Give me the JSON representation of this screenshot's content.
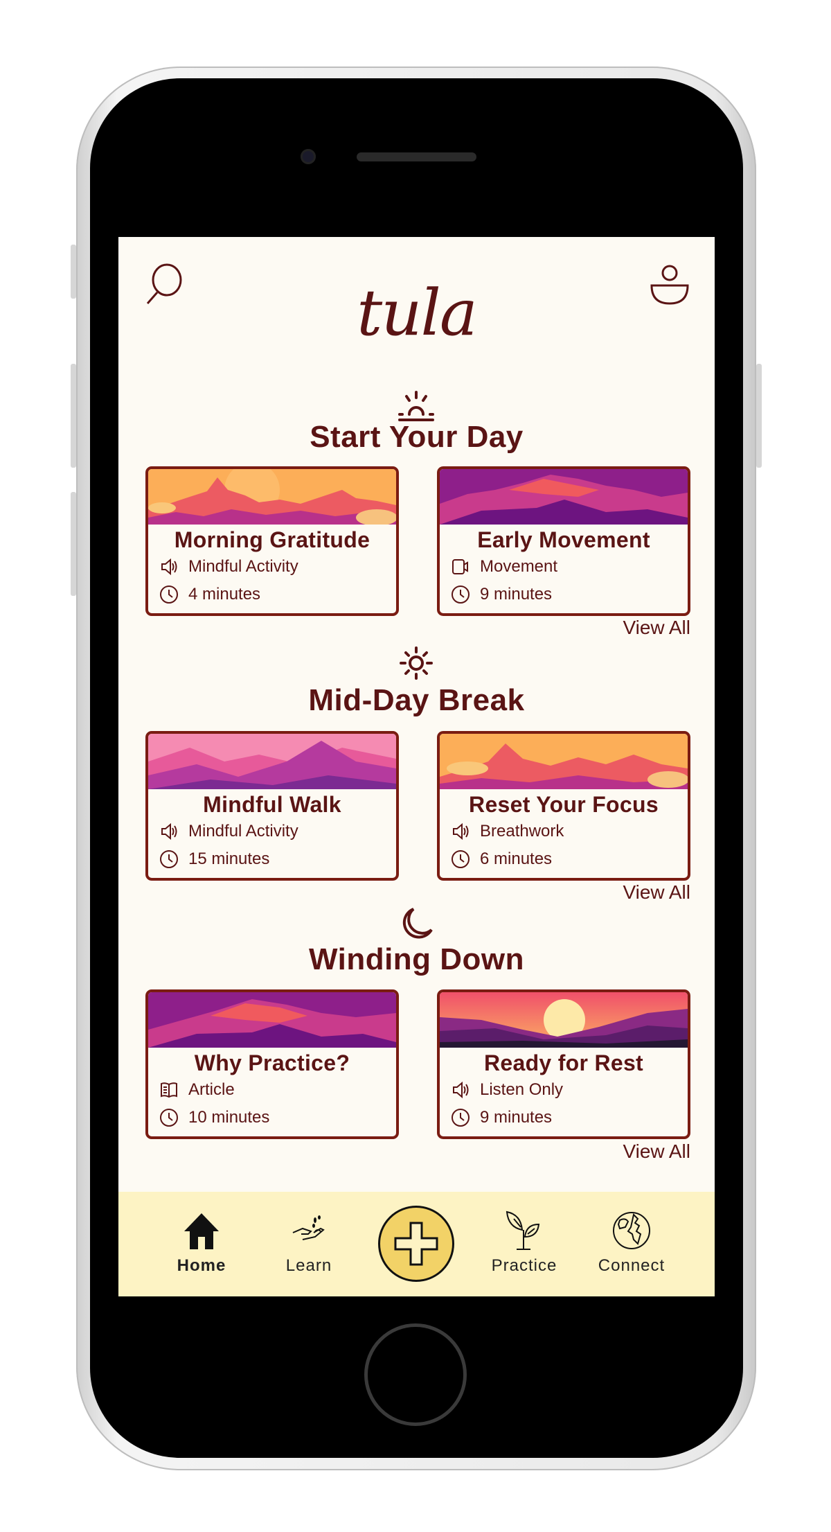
{
  "app": {
    "logo": "tula"
  },
  "header": {
    "search_icon": "search-icon",
    "profile_icon": "user-icon"
  },
  "colors": {
    "text": "#5a1414",
    "background": "#fdfaf3",
    "nav_background": "#fdf3c4",
    "add_button": "#f2d267",
    "card_border": "#7a1c12"
  },
  "sections": [
    {
      "icon": "sunrise-icon",
      "title": "Start Your Day",
      "view_all": "View All",
      "cards": [
        {
          "title": "Morning Gratitude",
          "type_icon": "speaker-icon",
          "type": "Mindful Activity",
          "duration": "4 minutes"
        },
        {
          "title": "Early Movement",
          "type_icon": "video-icon",
          "type": "Movement",
          "duration": "9 minutes"
        }
      ]
    },
    {
      "icon": "sun-icon",
      "title": "Mid-Day Break",
      "view_all": "View All",
      "cards": [
        {
          "title": "Mindful Walk",
          "type_icon": "speaker-icon",
          "type": "Mindful Activity",
          "duration": "15 minutes"
        },
        {
          "title": "Reset Your Focus",
          "type_icon": "speaker-icon",
          "type": "Breathwork",
          "duration": "6 minutes"
        }
      ]
    },
    {
      "icon": "moon-icon",
      "title": "Winding Down",
      "view_all": "View All",
      "cards": [
        {
          "title": "Why Practice?",
          "type_icon": "book-icon",
          "type": "Article",
          "duration": "10 minutes"
        },
        {
          "title": "Ready for Rest",
          "type_icon": "speaker-icon",
          "type": "Listen Only",
          "duration": "9 minutes"
        }
      ]
    }
  ],
  "nav": {
    "items": [
      {
        "label": "Home",
        "icon": "home-icon",
        "active": true
      },
      {
        "label": "Learn",
        "icon": "hand-seeds-icon"
      },
      {
        "label": "",
        "icon": "plus-icon"
      },
      {
        "label": "Practice",
        "icon": "sprout-icon"
      },
      {
        "label": "Connect",
        "icon": "globe-icon"
      }
    ]
  }
}
